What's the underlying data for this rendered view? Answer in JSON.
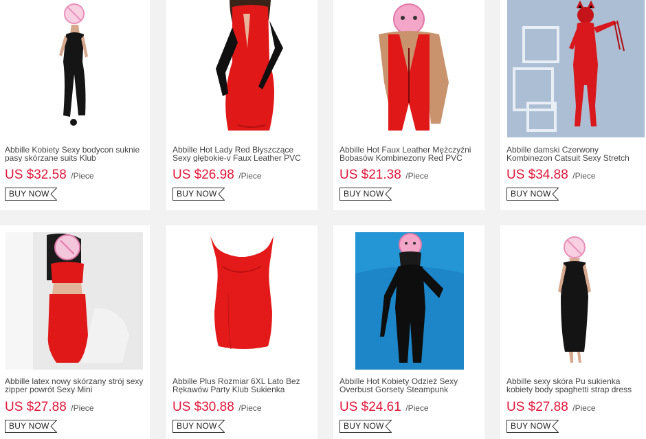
{
  "products": [
    {
      "title": "Abbille Kobiety Sexy bodycon suknie pasy skórzane suits Klub",
      "price": "US $32.58",
      "unit": "/Piece",
      "cta": "BUY NOW",
      "image_icon": "woman-black-latex-dress-photo"
    },
    {
      "title": "Abbille Hot Lady Red Błyszczące Sexy głębokie-v Faux Leather PVC",
      "price": "US $26.98",
      "unit": "/Piece",
      "cta": "BUY NOW",
      "image_icon": "woman-red-vinyl-dress-gloves-photo"
    },
    {
      "title": "Abbille Hot Faux Leather Mężczyźni Bobasów Kombinezony Red PVC",
      "price": "US $21.38",
      "unit": "/Piece",
      "cta": "BUY NOW",
      "image_icon": "man-red-pvc-romper-photo"
    },
    {
      "title": "Abbille damski Czerwony Kombinezon Catsuit Sexy Stretch",
      "price": "US $34.88",
      "unit": "/Piece",
      "cta": "BUY NOW",
      "image_icon": "woman-red-catsuit-photo"
    },
    {
      "title": "Abbille latex nowy skórzany strój sexy zipper powrót Sexy Mini",
      "price": "US $27.88",
      "unit": "/Piece",
      "cta": "BUY NOW",
      "image_icon": "woman-red-two-piece-photo"
    },
    {
      "title": "Abbille Plus Rozmiar 6XL Lato Bez Rękawów Party Klub Sukienka",
      "price": "US $30.88",
      "unit": "/Piece",
      "cta": "BUY NOW",
      "image_icon": "red-vinyl-dress-product-photo"
    },
    {
      "title": "Abbille Hot Kobiety Odzież Sexy Overbust Gorsety Steampunk",
      "price": "US $24.61",
      "unit": "/Piece",
      "cta": "BUY NOW",
      "image_icon": "woman-black-corset-dress-photo"
    },
    {
      "title": "Abbille sexy skóra Pu sukienka kobiety body spaghetti strap dress",
      "price": "US $27.88",
      "unit": "/Piece",
      "cta": "BUY NOW",
      "image_icon": "woman-black-pu-dress-photo"
    }
  ],
  "colors": {
    "price": "#e0173b",
    "background": "#f2f2f2",
    "red_garment": "#e01818",
    "black_garment": "#151515",
    "censor_pink": "#f4a6c8"
  }
}
